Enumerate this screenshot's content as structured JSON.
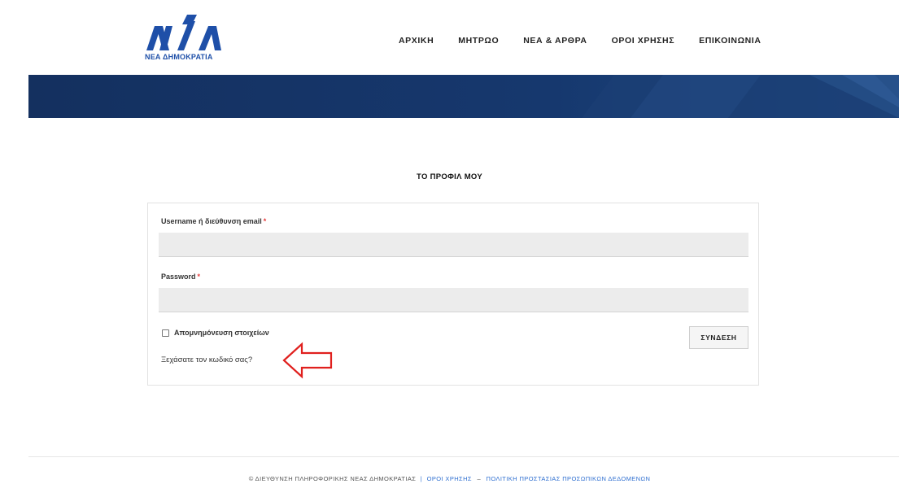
{
  "header": {
    "logo_text": "ΝΕΑ ΔΗΜΟΚΡΑΤΙΑ",
    "nav": [
      {
        "label": "ΑΡΧΙΚΗ"
      },
      {
        "label": "ΜΗΤΡΩΟ"
      },
      {
        "label": "ΝΕΑ & ΑΡΘΡΑ"
      },
      {
        "label": "ΟΡΟΙ ΧΡΗΣΗΣ"
      },
      {
        "label": "ΕΠΙΚΟΙΝΩΝΙΑ"
      }
    ]
  },
  "page": {
    "title": "ΤΟ ΠΡΟΦΙΛ ΜΟΥ"
  },
  "login_form": {
    "username_label": "Username ή διεύθυνση email",
    "username_value": "",
    "password_label": "Password",
    "password_value": "",
    "required_mark": "*",
    "remember_label": "Απομνημόνευση στοιχείων",
    "remember_checked": false,
    "submit_label": "ΣΥΝΔΕΣΗ",
    "forgot_link": "Ξεχάσατε τον κωδικό σας?"
  },
  "footer": {
    "copyright": "© ΔΙΕΥΘΥΝΣΗ ΠΛΗΡΟΦΟΡΙΚΗΣ ΝΕΑΣ ΔΗΜΟΚΡΑΤΙΑΣ",
    "separator": "|",
    "terms_link": "ΟΡΟΙ ΧΡΗΣΗΣ",
    "dash": "–",
    "privacy_link": "ΠΟΛΙΤΙΚΗ ΠΡΟΣΤΑΣΙΑΣ ΠΡΟΣΩΠΙΚΩΝ ΔΕΔΟΜΕΝΩΝ"
  },
  "colors": {
    "brand_blue": "#1e4fa8",
    "banner_dark": "#14305f",
    "link_blue": "#2f6fd0",
    "required_red": "#e63c3c",
    "annotation_red": "#e0201e"
  },
  "icons": {
    "logo": "nd-logo-icon",
    "annotation_arrow": "left-arrow-annotation-icon",
    "checkbox": "checkbox-icon"
  }
}
